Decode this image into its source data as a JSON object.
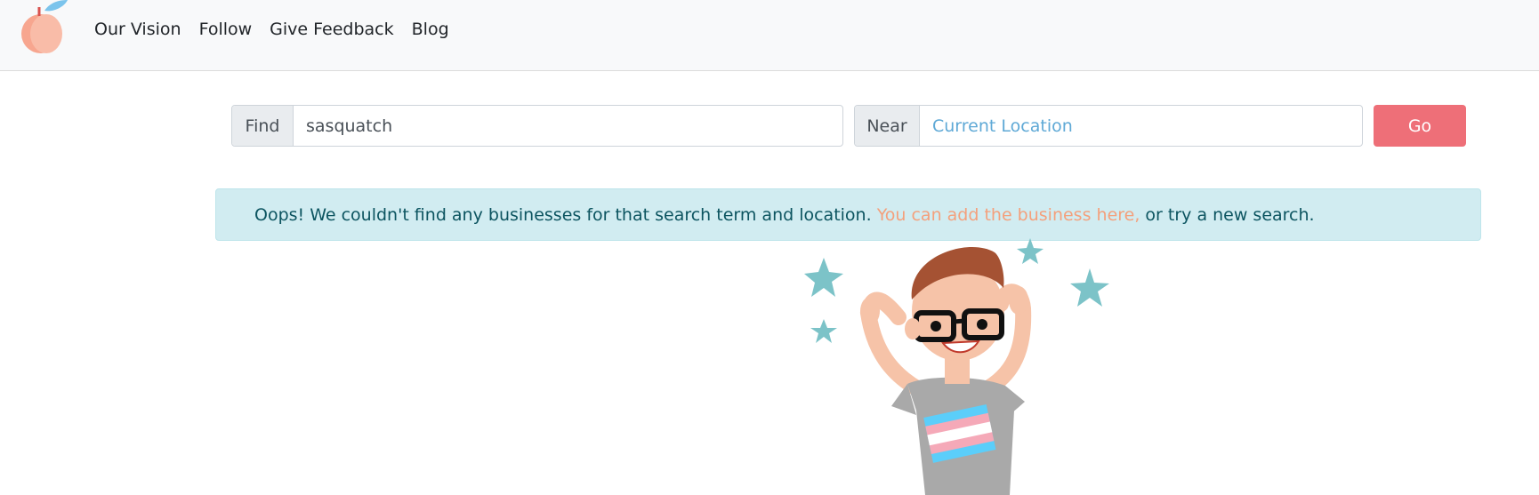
{
  "nav": {
    "logo_alt": "peach logo",
    "links": [
      "Our Vision",
      "Follow",
      "Give Feedback",
      "Blog"
    ]
  },
  "search": {
    "find_label": "Find",
    "find_value": "sasquatch",
    "near_label": "Near",
    "near_placeholder": "Current Location",
    "go_label": "Go"
  },
  "alert": {
    "text_before": "Oops! We couldn't find any businesses for that search term and location.",
    "link_text": "You can add the business here,",
    "text_after": "or try a new search."
  },
  "colors": {
    "accent": "#ee6f78",
    "alert_bg": "#d1ecf1",
    "alert_text": "#0c5460",
    "link": "#f4a07c",
    "star": "#7cc3c8"
  },
  "illustration": {
    "icon": "celebrating-person-illustration"
  }
}
